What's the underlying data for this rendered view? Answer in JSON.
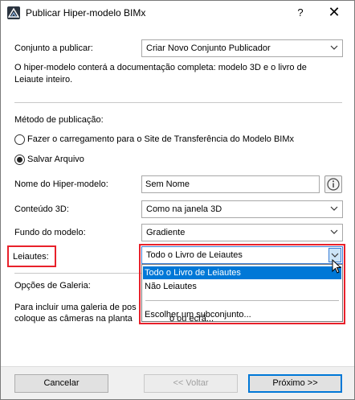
{
  "window": {
    "title": "Publicar Hiper-modelo BIMx",
    "help_label": "?",
    "close_label": "✕"
  },
  "set_section": {
    "label": "Conjunto a publicar:",
    "value": "Criar Novo Conjunto Publicador",
    "description_line1": "O hiper-modelo conterá a documentação completa: modelo 3D e o livro de",
    "description_line2": "Leiaute inteiro."
  },
  "publish_method": {
    "label": "Método de publicação:",
    "options": [
      {
        "label": "Fazer o carregamento para o Site de Transferência do Modelo BIMx",
        "selected": false
      },
      {
        "label": "Salvar Arquivo",
        "selected": true
      }
    ]
  },
  "form": {
    "model_name_label": "Nome do Hiper-modelo:",
    "model_name_value": "Sem Nome",
    "content_3d_label": "Conteúdo 3D:",
    "content_3d_value": "Como na janela 3D",
    "background_label": "Fundo do modelo:",
    "background_value": "Gradiente",
    "layouts_label": "Leiautes:",
    "layouts_value": "Todo o Livro de Leiautes"
  },
  "layouts_dropdown": {
    "options": [
      {
        "label": "Todo o Livro de Leiautes",
        "selected": true
      },
      {
        "label": "Não Leiautes",
        "selected": false
      },
      {
        "label": "Escolher um subconjunto...",
        "selected": false
      }
    ]
  },
  "gallery": {
    "label": "Opções de Galeria:",
    "text_line1": "Para incluir uma galeria de pos",
    "text_line2": "coloque as câmeras na planta",
    "text_line2_tail": "o ou ecrã..."
  },
  "buttons": {
    "cancel": "Cancelar",
    "back": "<< Voltar",
    "next": "Próximo >>"
  },
  "colors": {
    "highlight": "#e8212b",
    "selection": "#0078d7"
  }
}
